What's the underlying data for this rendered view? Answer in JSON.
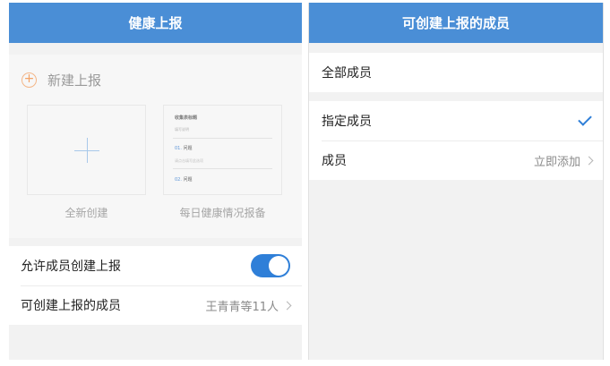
{
  "left": {
    "title": "健康上报",
    "new_report_label": "新建上报",
    "templates": [
      {
        "label": "全新创建"
      },
      {
        "label": "每日健康情况报备",
        "preview": {
          "title": "收集表标题",
          "subtitle": "填写说明",
          "q1": "01.",
          "q1_text": "问题",
          "q1_hint": "请点击填写此选项",
          "q2": "02.",
          "q2_text": "问题"
        }
      }
    ],
    "settings": {
      "allow_label": "允许成员创建上报",
      "allow_enabled": true,
      "members_label": "可创建上报的成员",
      "members_value": "王青青等11人"
    }
  },
  "right": {
    "title": "可创建上报的成员",
    "all_members": "全部成员",
    "specified_members": "指定成员",
    "specified_selected": true,
    "members_label": "成员",
    "add_now": "立即添加"
  },
  "colors": {
    "nav": "#4a8ed6",
    "accent": "#2f7fd8",
    "plus_orange": "#f4a265"
  }
}
